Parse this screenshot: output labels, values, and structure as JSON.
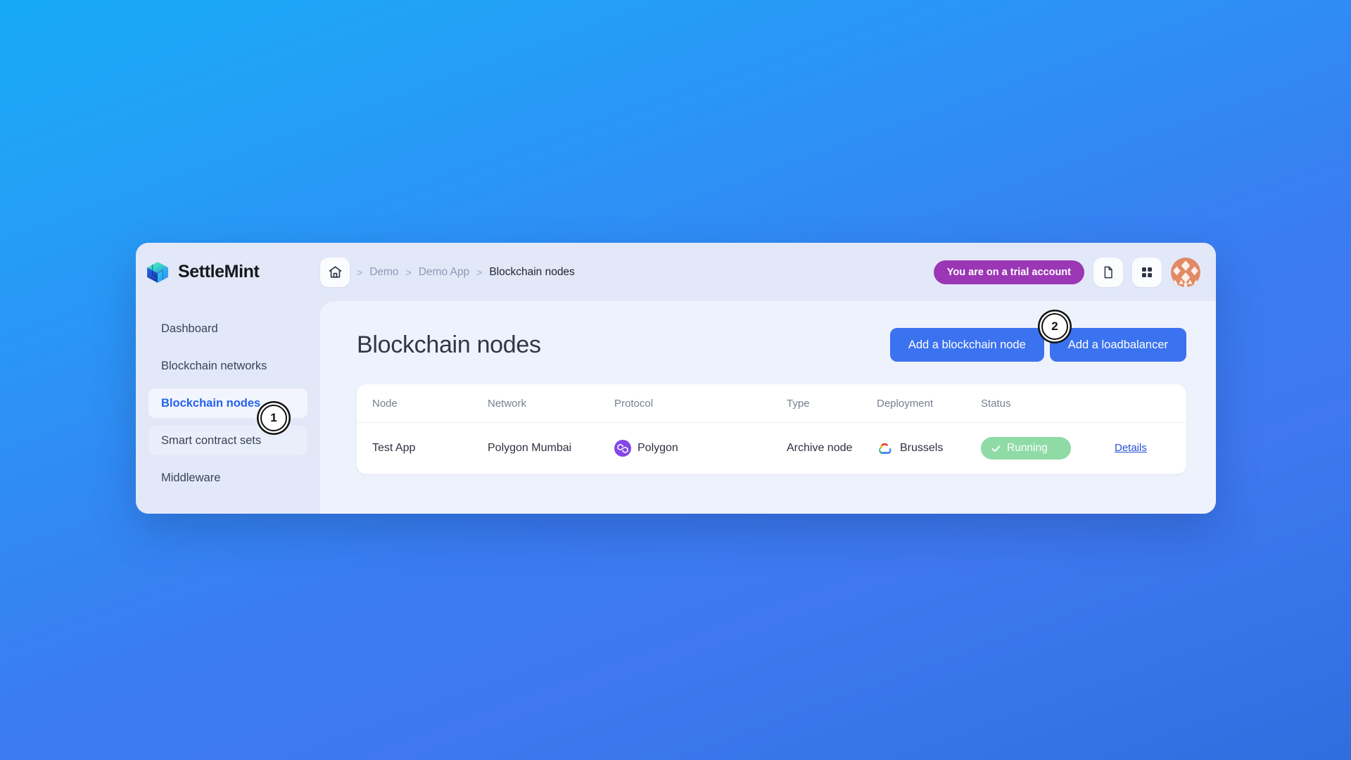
{
  "brand": {
    "name": "SettleMint",
    "logo_icon": "settlemint-cube-icon"
  },
  "topbar": {
    "home_icon": "home-icon",
    "breadcrumb": [
      {
        "label": "Demo",
        "current": false
      },
      {
        "label": "Demo App",
        "current": false
      },
      {
        "label": "Blockchain nodes",
        "current": true
      }
    ],
    "separator": ">",
    "trial_badge": "You are on a trial account",
    "doc_icon": "document-icon",
    "grid_icon": "grid-apps-icon",
    "avatar_icon": "user-avatar"
  },
  "sidebar": {
    "items": [
      {
        "label": "Dashboard",
        "state": "default"
      },
      {
        "label": "Blockchain networks",
        "state": "default"
      },
      {
        "label": "Blockchain nodes",
        "state": "active"
      },
      {
        "label": "Smart contract sets",
        "state": "hovered"
      },
      {
        "label": "Middleware",
        "state": "default"
      }
    ]
  },
  "main": {
    "title": "Blockchain nodes",
    "actions": {
      "add_node": "Add a blockchain node",
      "add_loadbalancer": "Add a loadbalancer"
    },
    "table": {
      "columns": [
        "Node",
        "Network",
        "Protocol",
        "Type",
        "Deployment",
        "Status",
        ""
      ],
      "rows": [
        {
          "node": "Test App",
          "network": "Polygon Mumbai",
          "protocol": "Polygon",
          "protocol_icon": "polygon-icon",
          "type": "Archive node",
          "deployment": "Brussels",
          "deployment_icon": "google-cloud-icon",
          "status": "Running",
          "status_icon": "check-icon",
          "action": "Details"
        }
      ]
    }
  },
  "annotations": [
    {
      "number": "1",
      "target": "sidebar-item-blockchain-nodes"
    },
    {
      "number": "2",
      "target": "add-loadbalancer-button"
    }
  ],
  "colors": {
    "accent_blue": "#3b72ef",
    "active_nav": "#2563ec",
    "trial_purple": "#9b37b5",
    "status_green": "#8fdba6",
    "polygon_purple": "#8247e5",
    "link_blue": "#2a4fd8"
  }
}
